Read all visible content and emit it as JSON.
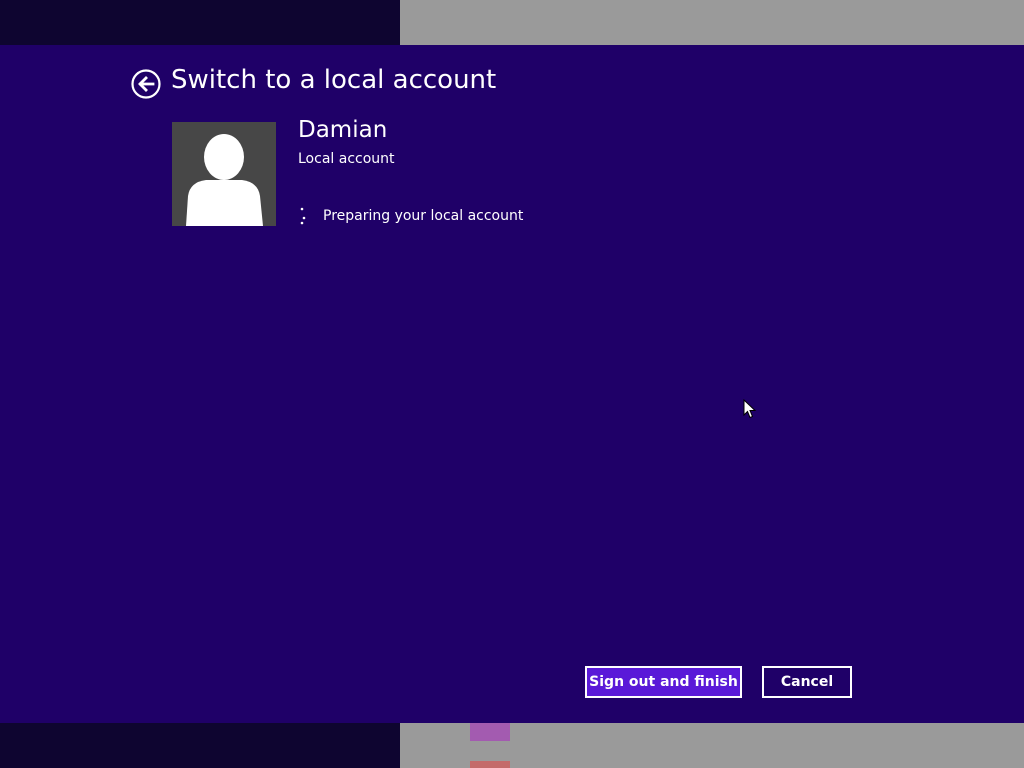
{
  "dialog": {
    "title": "Switch to a local account",
    "back_icon": "back-arrow-circle-icon",
    "user": {
      "name": "Damian",
      "account_type": "Local account",
      "avatar_icon": "user-silhouette-icon"
    },
    "status": {
      "text": "Preparing your local account",
      "icon": "loading-spinner-icon"
    },
    "buttons": {
      "primary_label": "Sign out and finish",
      "cancel_label": "Cancel"
    }
  },
  "colors": {
    "dialog_background": "#1f0068",
    "primary_button": "#5a19d8",
    "avatar_background": "#474747",
    "text": "#ffffff"
  }
}
